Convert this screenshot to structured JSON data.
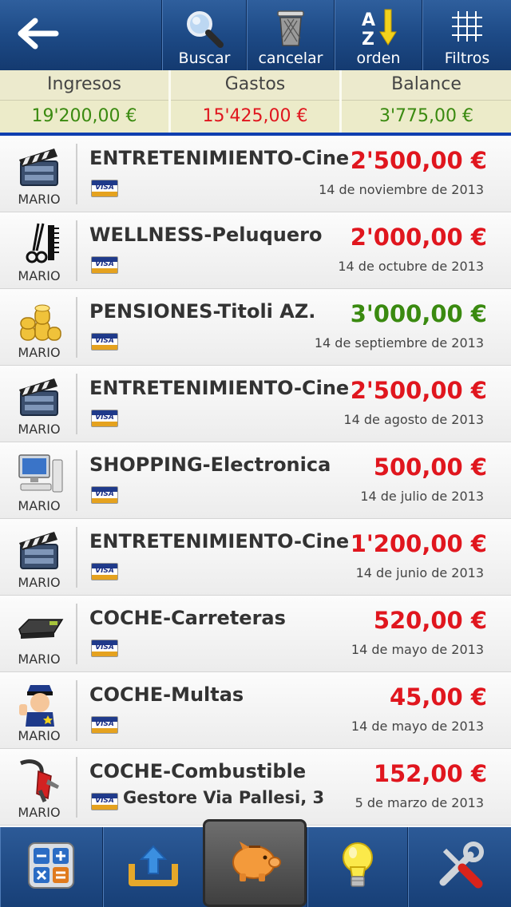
{
  "toolbar": {
    "back_icon": "back-arrow-icon",
    "buttons": [
      {
        "label": "Buscar",
        "icon": "magnifier-icon"
      },
      {
        "label": "cancelar",
        "icon": "trash-icon"
      },
      {
        "label": "orden",
        "icon": "sort-az-icon"
      },
      {
        "label": "Filtros",
        "icon": "grid-icon"
      }
    ]
  },
  "summary": {
    "ingresos_label": "Ingresos",
    "ingresos_value": "19'200,00 €",
    "gastos_label": "Gastos",
    "gastos_value": "15'425,00 €",
    "balance_label": "Balance",
    "balance_value": "3'775,00 €"
  },
  "colors": {
    "negative": "#e0161e",
    "positive": "#3a8a10",
    "accent": "#0f3fb0"
  },
  "rows": [
    {
      "title": "ENTRETENIMIENTO-Cine",
      "amount": "2'500,00 €",
      "date": "14 de noviembre de 2013",
      "user": "MARIO",
      "icon": "clapperboard-icon",
      "card": "VISA",
      "note": "",
      "sign": "neg"
    },
    {
      "title": "WELLNESS-Peluquero",
      "amount": "2'000,00 €",
      "date": "14 de octubre de 2013",
      "user": "MARIO",
      "icon": "scissors-comb-icon",
      "card": "VISA",
      "note": "",
      "sign": "neg"
    },
    {
      "title": "PENSIONES-Titoli  AZ.",
      "amount": "3'000,00 €",
      "date": "14 de septiembre de 2013",
      "user": "MARIO",
      "icon": "coins-icon",
      "card": "VISA",
      "note": "",
      "sign": "pos"
    },
    {
      "title": "ENTRETENIMIENTO-Cine",
      "amount": "2'500,00 €",
      "date": "14 de agosto de 2013",
      "user": "MARIO",
      "icon": "clapperboard-icon",
      "card": "VISA",
      "note": "",
      "sign": "neg"
    },
    {
      "title": "SHOPPING-Electronica",
      "amount": "500,00 €",
      "date": "14 de julio de 2013",
      "user": "MARIO",
      "icon": "computer-icon",
      "card": "VISA",
      "note": "",
      "sign": "neg"
    },
    {
      "title": "ENTRETENIMIENTO-Cine",
      "amount": "1'200,00 €",
      "date": "14 de junio de 2013",
      "user": "MARIO",
      "icon": "clapperboard-icon",
      "card": "VISA",
      "note": "",
      "sign": "neg"
    },
    {
      "title": "COCHE-Carreteras",
      "amount": "520,00 €",
      "date": "14 de mayo de 2013",
      "user": "MARIO",
      "icon": "toll-device-icon",
      "card": "VISA",
      "note": "",
      "sign": "neg"
    },
    {
      "title": "COCHE-Multas",
      "amount": "45,00 €",
      "date": "14 de mayo de 2013",
      "user": "MARIO",
      "icon": "policeman-icon",
      "card": "VISA",
      "note": "",
      "sign": "neg"
    },
    {
      "title": "COCHE-Combustible",
      "amount": "152,00 €",
      "date": "5 de marzo de 2013",
      "user": "MARIO",
      "icon": "fuel-nozzle-icon",
      "card": "VISA",
      "note": "Gestore Via Pallesi, 3",
      "sign": "neg"
    }
  ],
  "tabbar": {
    "items": [
      {
        "icon": "calculator-icon"
      },
      {
        "icon": "upload-icon"
      },
      {
        "icon": "piggy-bank-icon",
        "active": true
      },
      {
        "icon": "lightbulb-icon"
      },
      {
        "icon": "tools-icon"
      }
    ]
  }
}
